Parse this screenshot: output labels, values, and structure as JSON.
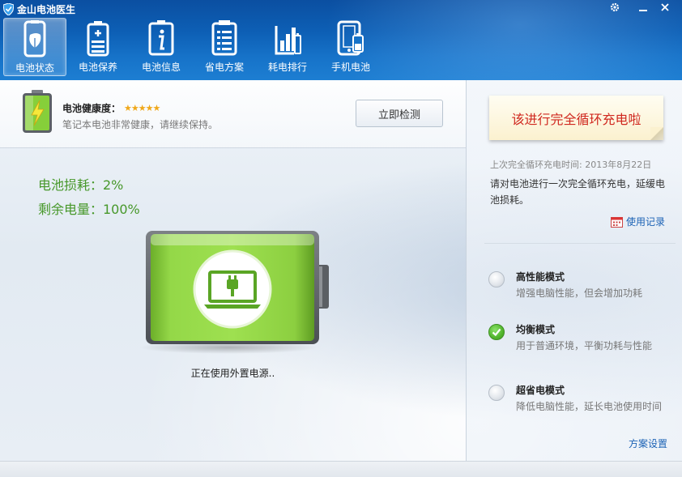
{
  "window": {
    "title": "金山电池医生",
    "settings_icon": "gear-icon",
    "minimize_icon": "minimize-icon",
    "close_icon": "close-icon"
  },
  "nav": {
    "items": [
      {
        "label": "电池状态",
        "icon": "battery-leaf-icon",
        "active": true
      },
      {
        "label": "电池保养",
        "icon": "battery-plus-icon",
        "active": false
      },
      {
        "label": "电池信息",
        "icon": "info-icon",
        "active": false
      },
      {
        "label": "省电方案",
        "icon": "list-icon",
        "active": false
      },
      {
        "label": "耗电排行",
        "icon": "bar-chart-icon",
        "active": false
      },
      {
        "label": "手机电池",
        "icon": "phone-battery-icon",
        "active": false
      }
    ]
  },
  "health": {
    "title": "电池健康度：",
    "stars": "★★★★★",
    "rating": 4.5,
    "description": "笔记本电池非常健康，请继续保持。",
    "detect_button": "立即检测"
  },
  "stats": {
    "loss": "电池损耗：2%",
    "remaining": "剩余电量：100%"
  },
  "power_status": "正在使用外置电源..",
  "colors": {
    "accent_green": "#47982a",
    "battery_green": "#8ed13d",
    "link_blue": "#1b62b5",
    "warning_red": "#d0281f",
    "toolbar_blue": "#0d5fb5"
  },
  "right": {
    "note": "该进行完全循环充电啦",
    "last_charge": "上次完全循环充电时间: 2013年8月22日",
    "advice": "请对电池进行一次完全循环充电，延缓电池损耗。",
    "usage_link": "使用记录",
    "modes": [
      {
        "title": "高性能模式",
        "desc": "增强电脑性能，但会增加功耗",
        "checked": false
      },
      {
        "title": "均衡模式",
        "desc": "用于普通环境，平衡功耗与性能",
        "checked": true
      },
      {
        "title": "超省电模式",
        "desc": "降低电脑性能，延长电池使用时间",
        "checked": false
      }
    ],
    "plan_settings": "方案设置"
  }
}
